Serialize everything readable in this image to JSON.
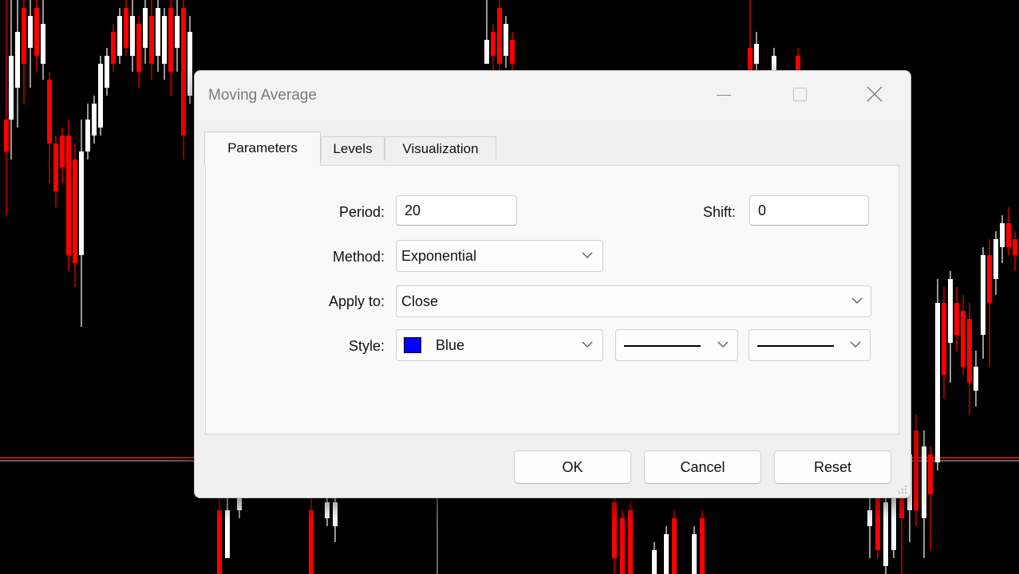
{
  "dialog": {
    "title": "Moving Average",
    "tabs": [
      {
        "label": "Parameters",
        "active": true
      },
      {
        "label": "Levels",
        "active": false
      },
      {
        "label": "Visualization",
        "active": false
      }
    ],
    "fields": {
      "period": {
        "label": "Period:",
        "value": "20"
      },
      "shift": {
        "label": "Shift:",
        "value": "0"
      },
      "method": {
        "label": "Method:",
        "value": "Exponential"
      },
      "apply_to": {
        "label": "Apply to:",
        "value": "Close"
      },
      "style": {
        "label": "Style:",
        "color_name": "Blue",
        "color": "#0000ff"
      }
    },
    "buttons": {
      "ok": "OK",
      "cancel": "Cancel",
      "reset": "Reset"
    }
  },
  "colors": {
    "chart_background": "#000000",
    "bull_candle": "#ffffff",
    "bear_candle": "#ff0000",
    "horizontal_line": "#ff0000"
  }
}
